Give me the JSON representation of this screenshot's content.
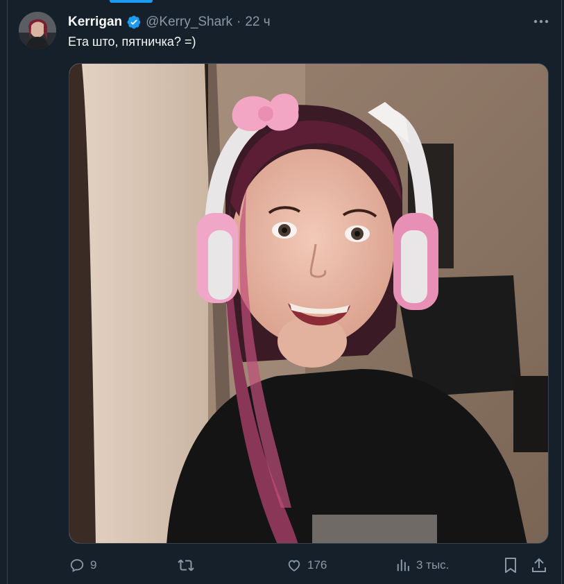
{
  "tweet": {
    "author": {
      "display_name": "Kerrigan",
      "handle": "@Kerry_Shark",
      "verified": true
    },
    "separator": "·",
    "time": "22 ч",
    "text": "Ета што, пятничка? =)",
    "media": {
      "type": "photo"
    }
  },
  "actions": {
    "reply_count": "9",
    "retweet_count": "",
    "like_count": "176",
    "views_count": "3 тыс."
  },
  "icons": {
    "verified": "verified-badge-icon",
    "more": "more-dots-icon",
    "reply": "reply-icon",
    "retweet": "retweet-icon",
    "like": "heart-icon",
    "views": "views-bars-icon",
    "bookmark": "bookmark-icon",
    "share": "share-icon"
  },
  "colors": {
    "background": "#15202b",
    "text": "#f7f9f9",
    "muted": "#8b98a5",
    "accent": "#1d9bf0",
    "border": "#38444d"
  }
}
